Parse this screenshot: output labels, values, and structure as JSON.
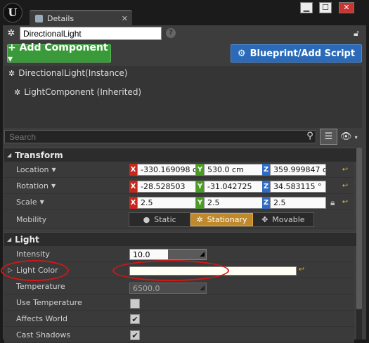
{
  "window": {
    "tab_title": "Details",
    "logo_text": "U",
    "min_symbol": "▁",
    "max_symbol": "☐",
    "close_symbol": "✕",
    "tab_close": "✕"
  },
  "actor": {
    "name": "DirectionalLight",
    "help": "?"
  },
  "buttons": {
    "add_component": "+ Add Component ▾",
    "blueprint": "Blueprint/Add Script"
  },
  "components": [
    {
      "label": "DirectionalLight(Instance)"
    },
    {
      "label": "LightComponent (Inherited)"
    }
  ],
  "search": {
    "placeholder": "Search"
  },
  "sections": {
    "transform": {
      "title": "Transform",
      "location": {
        "label": "Location",
        "x": "-330.169098 c",
        "y": "530.0 cm",
        "z": "359.999847 cr"
      },
      "rotation": {
        "label": "Rotation",
        "x": "-28.528503",
        "y": "-31.042725",
        "z": "34.583115 °"
      },
      "scale": {
        "label": "Scale",
        "x": "2.5",
        "y": "2.5",
        "z": "2.5"
      },
      "mobility": {
        "label": "Mobility",
        "options": [
          "Static",
          "Stationary",
          "Movable"
        ],
        "selected": "Stationary"
      }
    },
    "light": {
      "title": "Light",
      "intensity": {
        "label": "Intensity",
        "value": "10.0",
        "fill_fraction": 0.5
      },
      "light_color": {
        "label": "Light Color",
        "value": "#fffff4"
      },
      "temperature": {
        "label": "Temperature",
        "value": "6500.0"
      },
      "use_temperature": {
        "label": "Use Temperature",
        "checked": false
      },
      "affects_world": {
        "label": "Affects World",
        "checked": true
      },
      "cast_shadows": {
        "label": "Cast Shadows",
        "checked": true
      }
    }
  },
  "axis_labels": {
    "x": "X",
    "y": "Y",
    "z": "Z"
  },
  "colors": {
    "axis_x": "#c9261c",
    "axis_y": "#4b9c25",
    "axis_z": "#2f6ac4",
    "active_mobility": "#c08a2c",
    "annotation": "#d01818"
  },
  "icons": {
    "reset": "reset-arrow-icon",
    "lock": "lock-icon",
    "check": "✔"
  }
}
